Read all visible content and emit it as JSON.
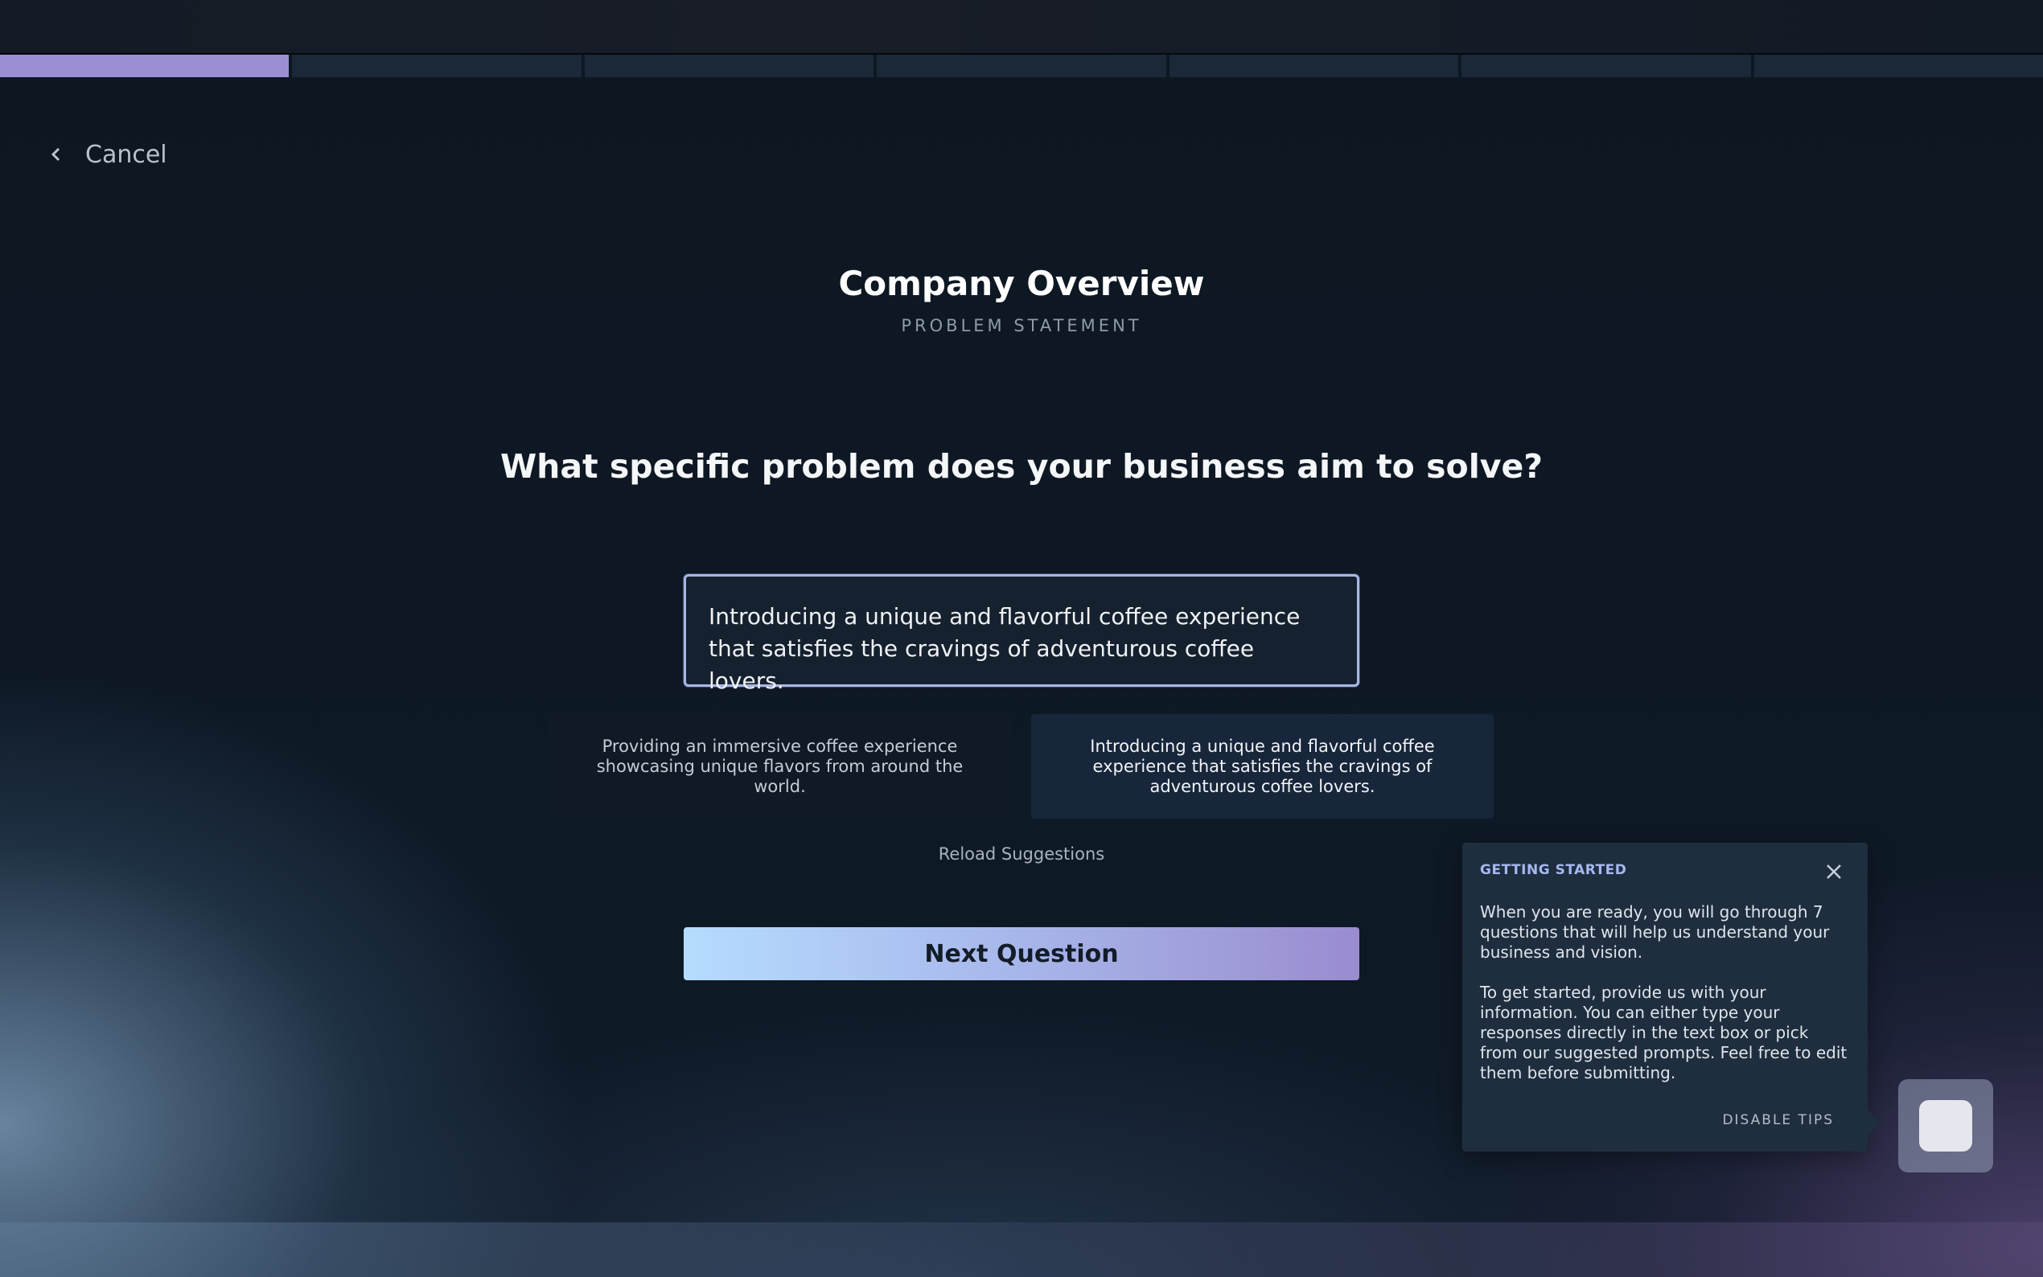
{
  "progress": {
    "total_steps": 7,
    "current_step": 1
  },
  "nav": {
    "cancel_label": "Cancel"
  },
  "header": {
    "title": "Company Overview",
    "subtitle": "PROBLEM STATEMENT"
  },
  "question": {
    "text": "What specific problem does your business aim to solve?"
  },
  "answer": {
    "value": "Introducing a unique and flavorful coffee experience that satisfies the cravings of adventurous coffee lovers."
  },
  "suggestions": [
    {
      "text": "Providing an immersive coffee experience showcasing unique flavors from around the world."
    },
    {
      "text": "Introducing a unique and flavorful coffee experience that satisfies the cravings of adventurous coffee lovers."
    }
  ],
  "reload_label": "Reload Suggestions",
  "next_label": "Next Question",
  "tip": {
    "heading": "GETTING STARTED",
    "paragraph1": "When you are ready, you will go through 7 questions that will help us understand your business and vision.",
    "paragraph2": "To get started, provide us with your information. You can either type your responses directly in the text box or pick from our suggested prompts. Feel free to edit them before submitting.",
    "disable_label": "DISABLE TIPS"
  },
  "colors": {
    "accent": "#9b8fd2",
    "button_start": "#b5dcff",
    "button_end": "#9a8ccf",
    "panel": "#1e2e3f"
  },
  "icons": {
    "cancel": "chevron-left-icon",
    "close": "close-icon",
    "helper": "assistant-icon"
  }
}
